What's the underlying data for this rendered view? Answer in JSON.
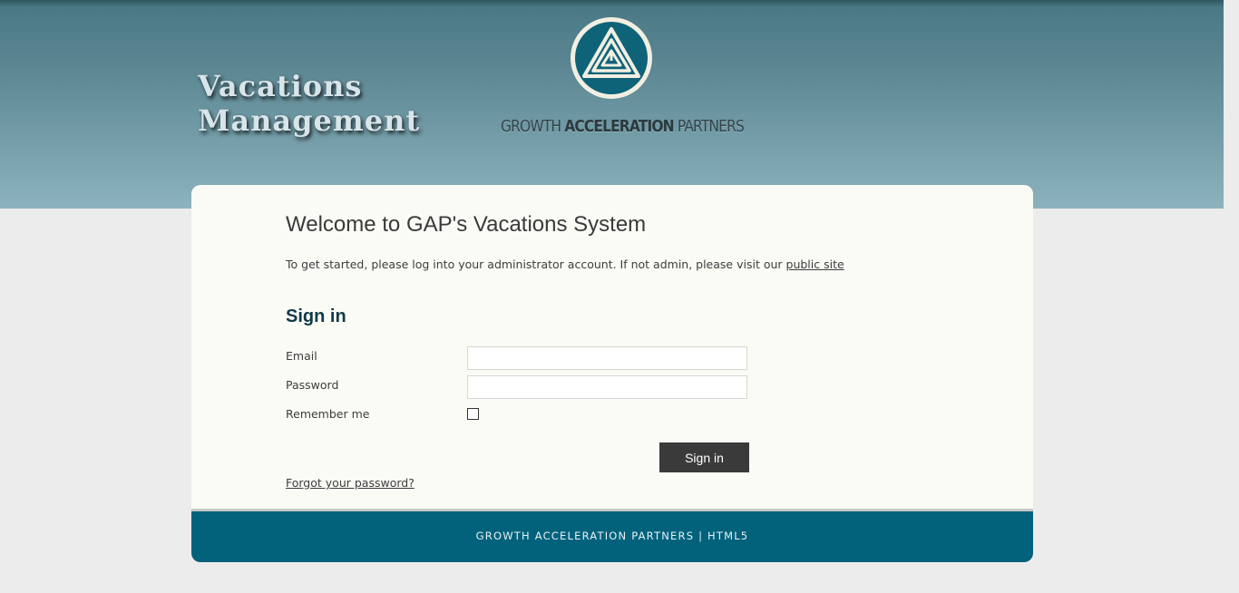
{
  "header": {
    "site_title_line1": "Vacations",
    "site_title_line2": "Management",
    "logo_text_part1": "GROWTH ",
    "logo_text_part2": "ACCELERATION",
    "logo_text_part3": " PARTNERS"
  },
  "main": {
    "welcome_title": "Welcome to GAP's Vacations System",
    "intro_text": "To get started, please log into your administrator account. If not admin, please visit our ",
    "public_site_link": "public site",
    "signin_heading": "Sign in"
  },
  "form": {
    "email_label": "Email",
    "email_value": "",
    "password_label": "Password",
    "password_value": "",
    "remember_label": "Remember me",
    "remember_checked": false,
    "submit_label": "Sign in",
    "forgot_link": "Forgot your password?"
  },
  "footer": {
    "company": "GROWTH ACCELERATION PARTNERS",
    "separator": "|",
    "tech": "HTML5"
  },
  "colors": {
    "header_top": "#3f6b77",
    "header_bottom": "#8cb3bd",
    "logo_teal": "#0f6378",
    "footer_bg": "#02627c",
    "button_bg": "#3a3a3a",
    "panel_bg": "#fafbf5",
    "heading_color": "#113a48"
  }
}
